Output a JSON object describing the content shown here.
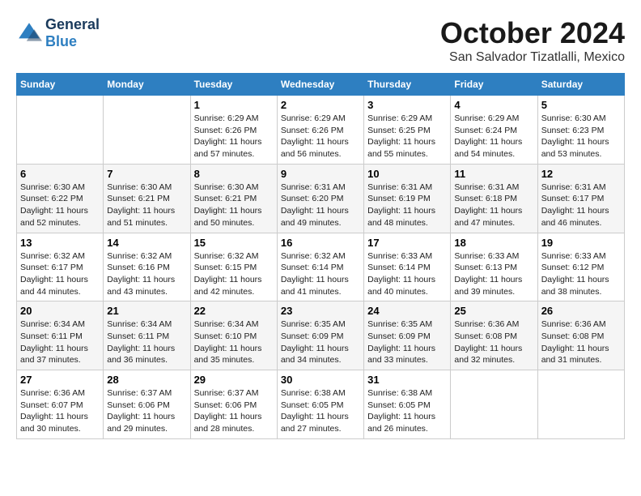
{
  "header": {
    "logo_line1": "General",
    "logo_line2": "Blue",
    "month": "October 2024",
    "location": "San Salvador Tizatlalli, Mexico"
  },
  "weekdays": [
    "Sunday",
    "Monday",
    "Tuesday",
    "Wednesday",
    "Thursday",
    "Friday",
    "Saturday"
  ],
  "weeks": [
    [
      {
        "day": "",
        "text": ""
      },
      {
        "day": "",
        "text": ""
      },
      {
        "day": "1",
        "text": "Sunrise: 6:29 AM\nSunset: 6:26 PM\nDaylight: 11 hours and 57 minutes."
      },
      {
        "day": "2",
        "text": "Sunrise: 6:29 AM\nSunset: 6:26 PM\nDaylight: 11 hours and 56 minutes."
      },
      {
        "day": "3",
        "text": "Sunrise: 6:29 AM\nSunset: 6:25 PM\nDaylight: 11 hours and 55 minutes."
      },
      {
        "day": "4",
        "text": "Sunrise: 6:29 AM\nSunset: 6:24 PM\nDaylight: 11 hours and 54 minutes."
      },
      {
        "day": "5",
        "text": "Sunrise: 6:30 AM\nSunset: 6:23 PM\nDaylight: 11 hours and 53 minutes."
      }
    ],
    [
      {
        "day": "6",
        "text": "Sunrise: 6:30 AM\nSunset: 6:22 PM\nDaylight: 11 hours and 52 minutes."
      },
      {
        "day": "7",
        "text": "Sunrise: 6:30 AM\nSunset: 6:21 PM\nDaylight: 11 hours and 51 minutes."
      },
      {
        "day": "8",
        "text": "Sunrise: 6:30 AM\nSunset: 6:21 PM\nDaylight: 11 hours and 50 minutes."
      },
      {
        "day": "9",
        "text": "Sunrise: 6:31 AM\nSunset: 6:20 PM\nDaylight: 11 hours and 49 minutes."
      },
      {
        "day": "10",
        "text": "Sunrise: 6:31 AM\nSunset: 6:19 PM\nDaylight: 11 hours and 48 minutes."
      },
      {
        "day": "11",
        "text": "Sunrise: 6:31 AM\nSunset: 6:18 PM\nDaylight: 11 hours and 47 minutes."
      },
      {
        "day": "12",
        "text": "Sunrise: 6:31 AM\nSunset: 6:17 PM\nDaylight: 11 hours and 46 minutes."
      }
    ],
    [
      {
        "day": "13",
        "text": "Sunrise: 6:32 AM\nSunset: 6:17 PM\nDaylight: 11 hours and 44 minutes."
      },
      {
        "day": "14",
        "text": "Sunrise: 6:32 AM\nSunset: 6:16 PM\nDaylight: 11 hours and 43 minutes."
      },
      {
        "day": "15",
        "text": "Sunrise: 6:32 AM\nSunset: 6:15 PM\nDaylight: 11 hours and 42 minutes."
      },
      {
        "day": "16",
        "text": "Sunrise: 6:32 AM\nSunset: 6:14 PM\nDaylight: 11 hours and 41 minutes."
      },
      {
        "day": "17",
        "text": "Sunrise: 6:33 AM\nSunset: 6:14 PM\nDaylight: 11 hours and 40 minutes."
      },
      {
        "day": "18",
        "text": "Sunrise: 6:33 AM\nSunset: 6:13 PM\nDaylight: 11 hours and 39 minutes."
      },
      {
        "day": "19",
        "text": "Sunrise: 6:33 AM\nSunset: 6:12 PM\nDaylight: 11 hours and 38 minutes."
      }
    ],
    [
      {
        "day": "20",
        "text": "Sunrise: 6:34 AM\nSunset: 6:11 PM\nDaylight: 11 hours and 37 minutes."
      },
      {
        "day": "21",
        "text": "Sunrise: 6:34 AM\nSunset: 6:11 PM\nDaylight: 11 hours and 36 minutes."
      },
      {
        "day": "22",
        "text": "Sunrise: 6:34 AM\nSunset: 6:10 PM\nDaylight: 11 hours and 35 minutes."
      },
      {
        "day": "23",
        "text": "Sunrise: 6:35 AM\nSunset: 6:09 PM\nDaylight: 11 hours and 34 minutes."
      },
      {
        "day": "24",
        "text": "Sunrise: 6:35 AM\nSunset: 6:09 PM\nDaylight: 11 hours and 33 minutes."
      },
      {
        "day": "25",
        "text": "Sunrise: 6:36 AM\nSunset: 6:08 PM\nDaylight: 11 hours and 32 minutes."
      },
      {
        "day": "26",
        "text": "Sunrise: 6:36 AM\nSunset: 6:08 PM\nDaylight: 11 hours and 31 minutes."
      }
    ],
    [
      {
        "day": "27",
        "text": "Sunrise: 6:36 AM\nSunset: 6:07 PM\nDaylight: 11 hours and 30 minutes."
      },
      {
        "day": "28",
        "text": "Sunrise: 6:37 AM\nSunset: 6:06 PM\nDaylight: 11 hours and 29 minutes."
      },
      {
        "day": "29",
        "text": "Sunrise: 6:37 AM\nSunset: 6:06 PM\nDaylight: 11 hours and 28 minutes."
      },
      {
        "day": "30",
        "text": "Sunrise: 6:38 AM\nSunset: 6:05 PM\nDaylight: 11 hours and 27 minutes."
      },
      {
        "day": "31",
        "text": "Sunrise: 6:38 AM\nSunset: 6:05 PM\nDaylight: 11 hours and 26 minutes."
      },
      {
        "day": "",
        "text": ""
      },
      {
        "day": "",
        "text": ""
      }
    ]
  ]
}
